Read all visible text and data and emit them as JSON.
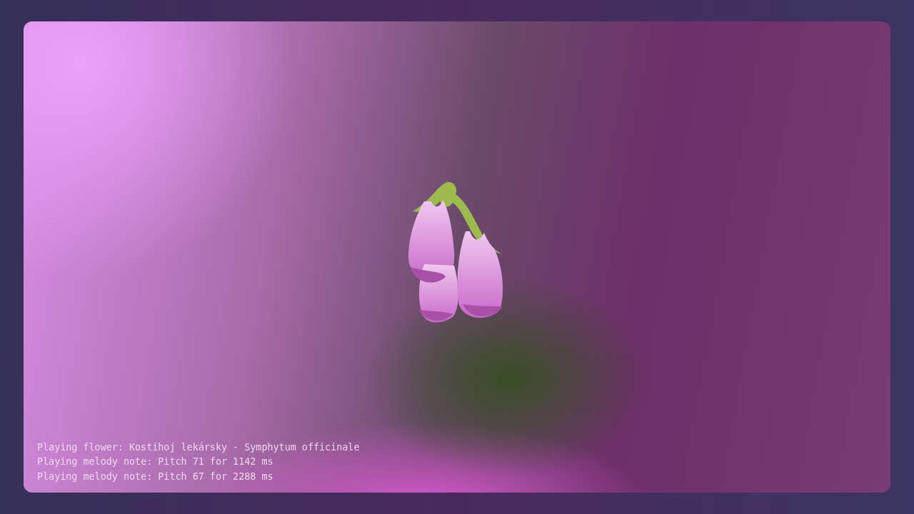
{
  "log": [
    "Playing flower: Kostihoj lekársky - Symphytum officinale",
    "Playing melody note: Pitch 71 for 1142 ms",
    "Playing melody note: Pitch 67 for 2288 ms"
  ]
}
